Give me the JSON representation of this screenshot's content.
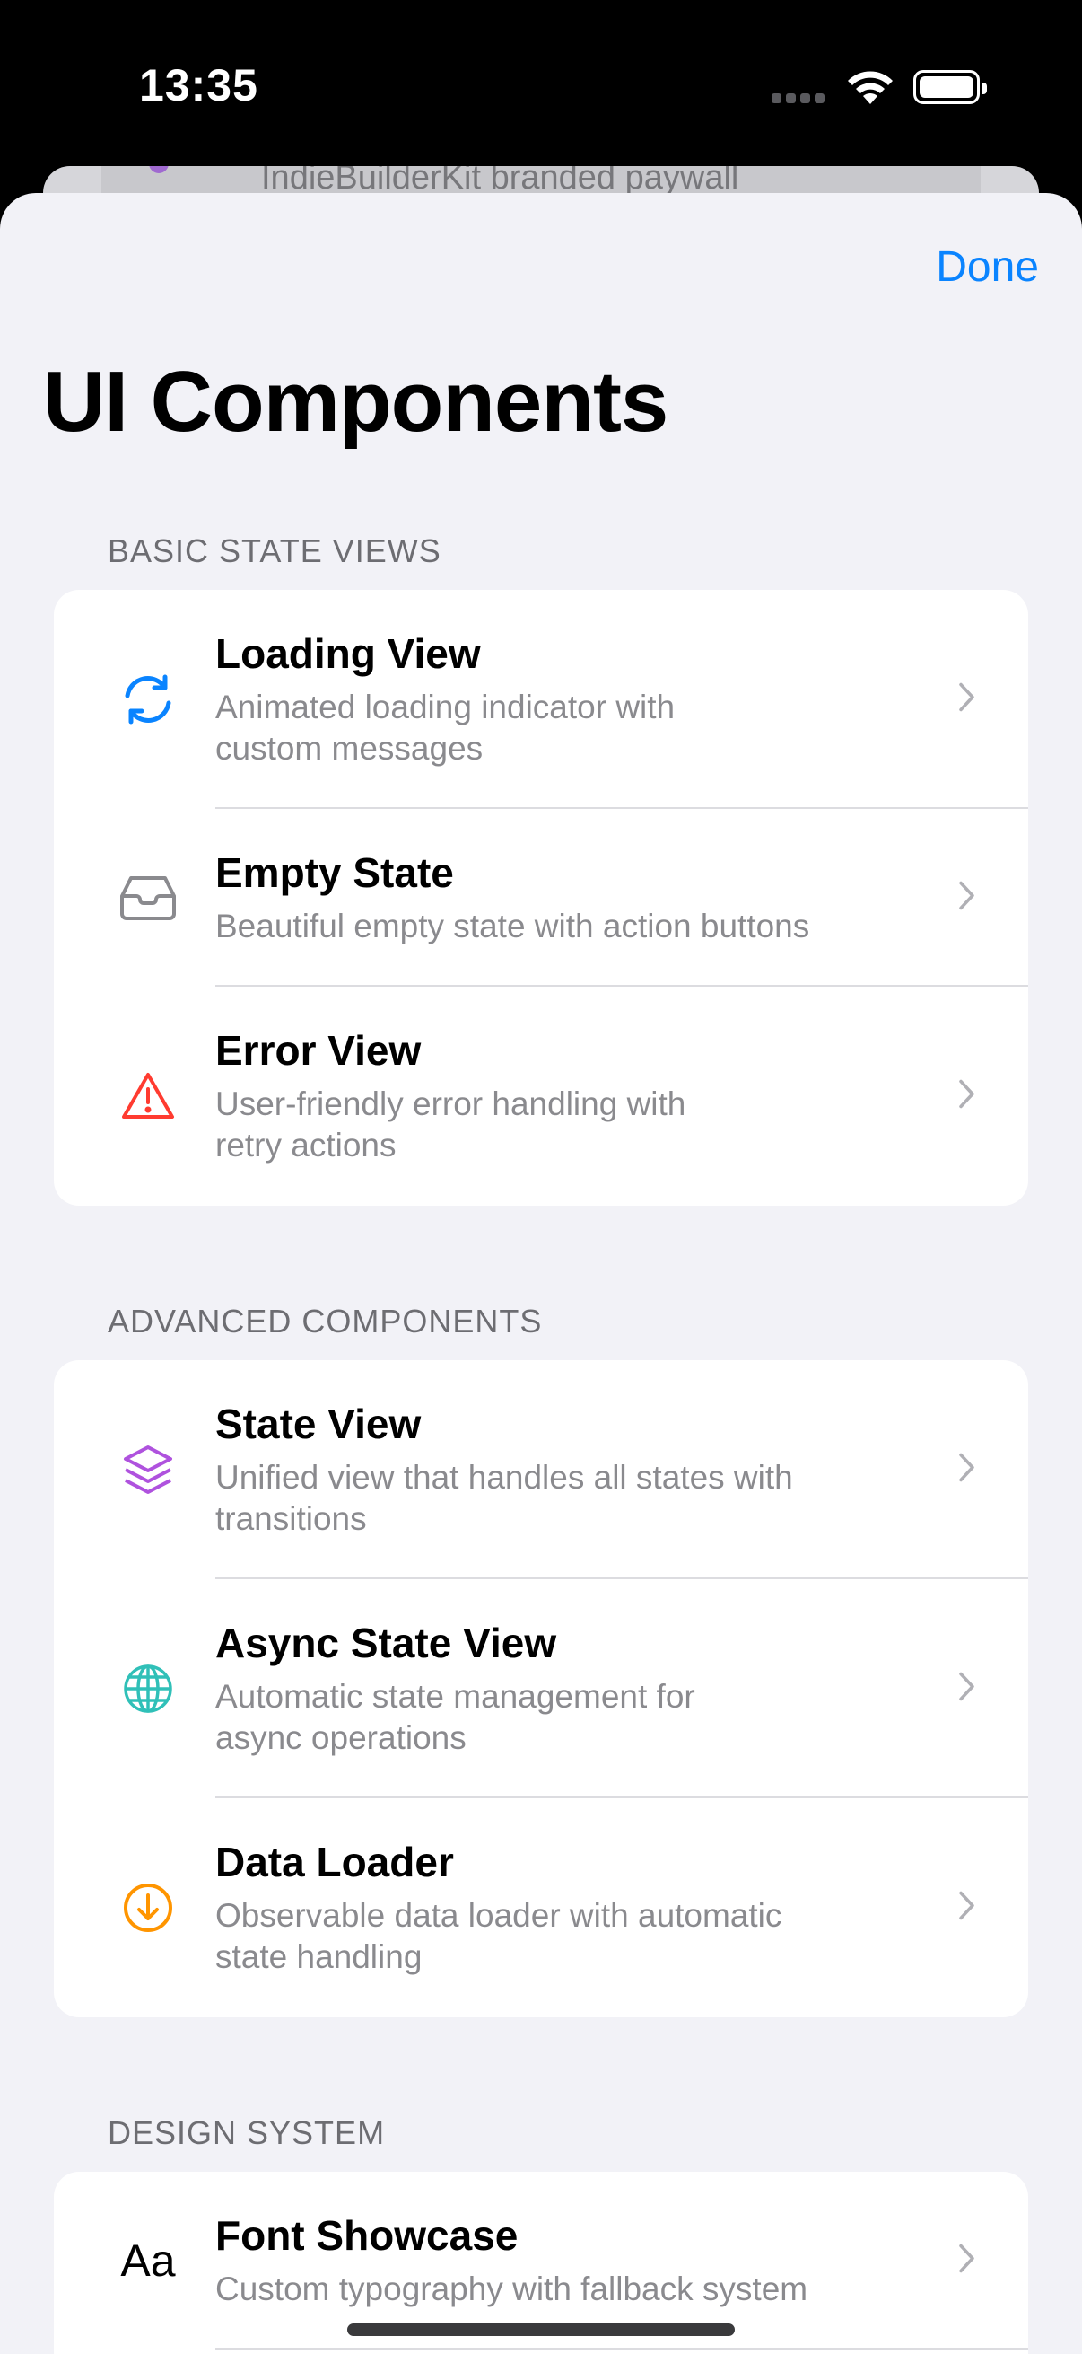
{
  "status": {
    "time": "13:35"
  },
  "background": {
    "peek_text": "IndieBuilderKit branded paywall"
  },
  "nav": {
    "done": "Done",
    "title": "UI Components"
  },
  "colors": {
    "accent": "#0a84ff",
    "sync": "#0a84ff",
    "warning": "#ff3b30",
    "layers": "#af52de",
    "globe": "#30c0b8",
    "download": "#ff9500"
  },
  "sections": [
    {
      "header": "BASIC STATE VIEWS",
      "items": [
        {
          "title": "Loading View",
          "subtitle_1": "Animated loading indicator with",
          "subtitle_2": "custom messages",
          "icon": "arrow-sync-icon"
        },
        {
          "title": "Empty State",
          "subtitle_1": "Beautiful empty state with action buttons",
          "subtitle_2": "",
          "icon": "tray-icon"
        },
        {
          "title": "Error View",
          "subtitle_1": "User-friendly error handling with",
          "subtitle_2": "retry actions",
          "icon": "warning-triangle-icon"
        }
      ]
    },
    {
      "header": "ADVANCED COMPONENTS",
      "items": [
        {
          "title": "State View",
          "subtitle_1": "Unified view that handles all states with",
          "subtitle_2": "transitions",
          "icon": "layers-icon"
        },
        {
          "title": "Async State View",
          "subtitle_1": "Automatic state management for",
          "subtitle_2": "async operations",
          "icon": "globe-icon"
        },
        {
          "title": "Data Loader",
          "subtitle_1": "Observable data loader with automatic",
          "subtitle_2": "state handling",
          "icon": "arrow-down-circle-icon"
        }
      ]
    },
    {
      "header": "DESIGN SYSTEM",
      "items": [
        {
          "title": "Font Showcase",
          "subtitle_1": "Custom typography with fallback system",
          "subtitle_2": "",
          "icon": "text-format-icon",
          "icon_text": "Aa"
        }
      ]
    }
  ]
}
